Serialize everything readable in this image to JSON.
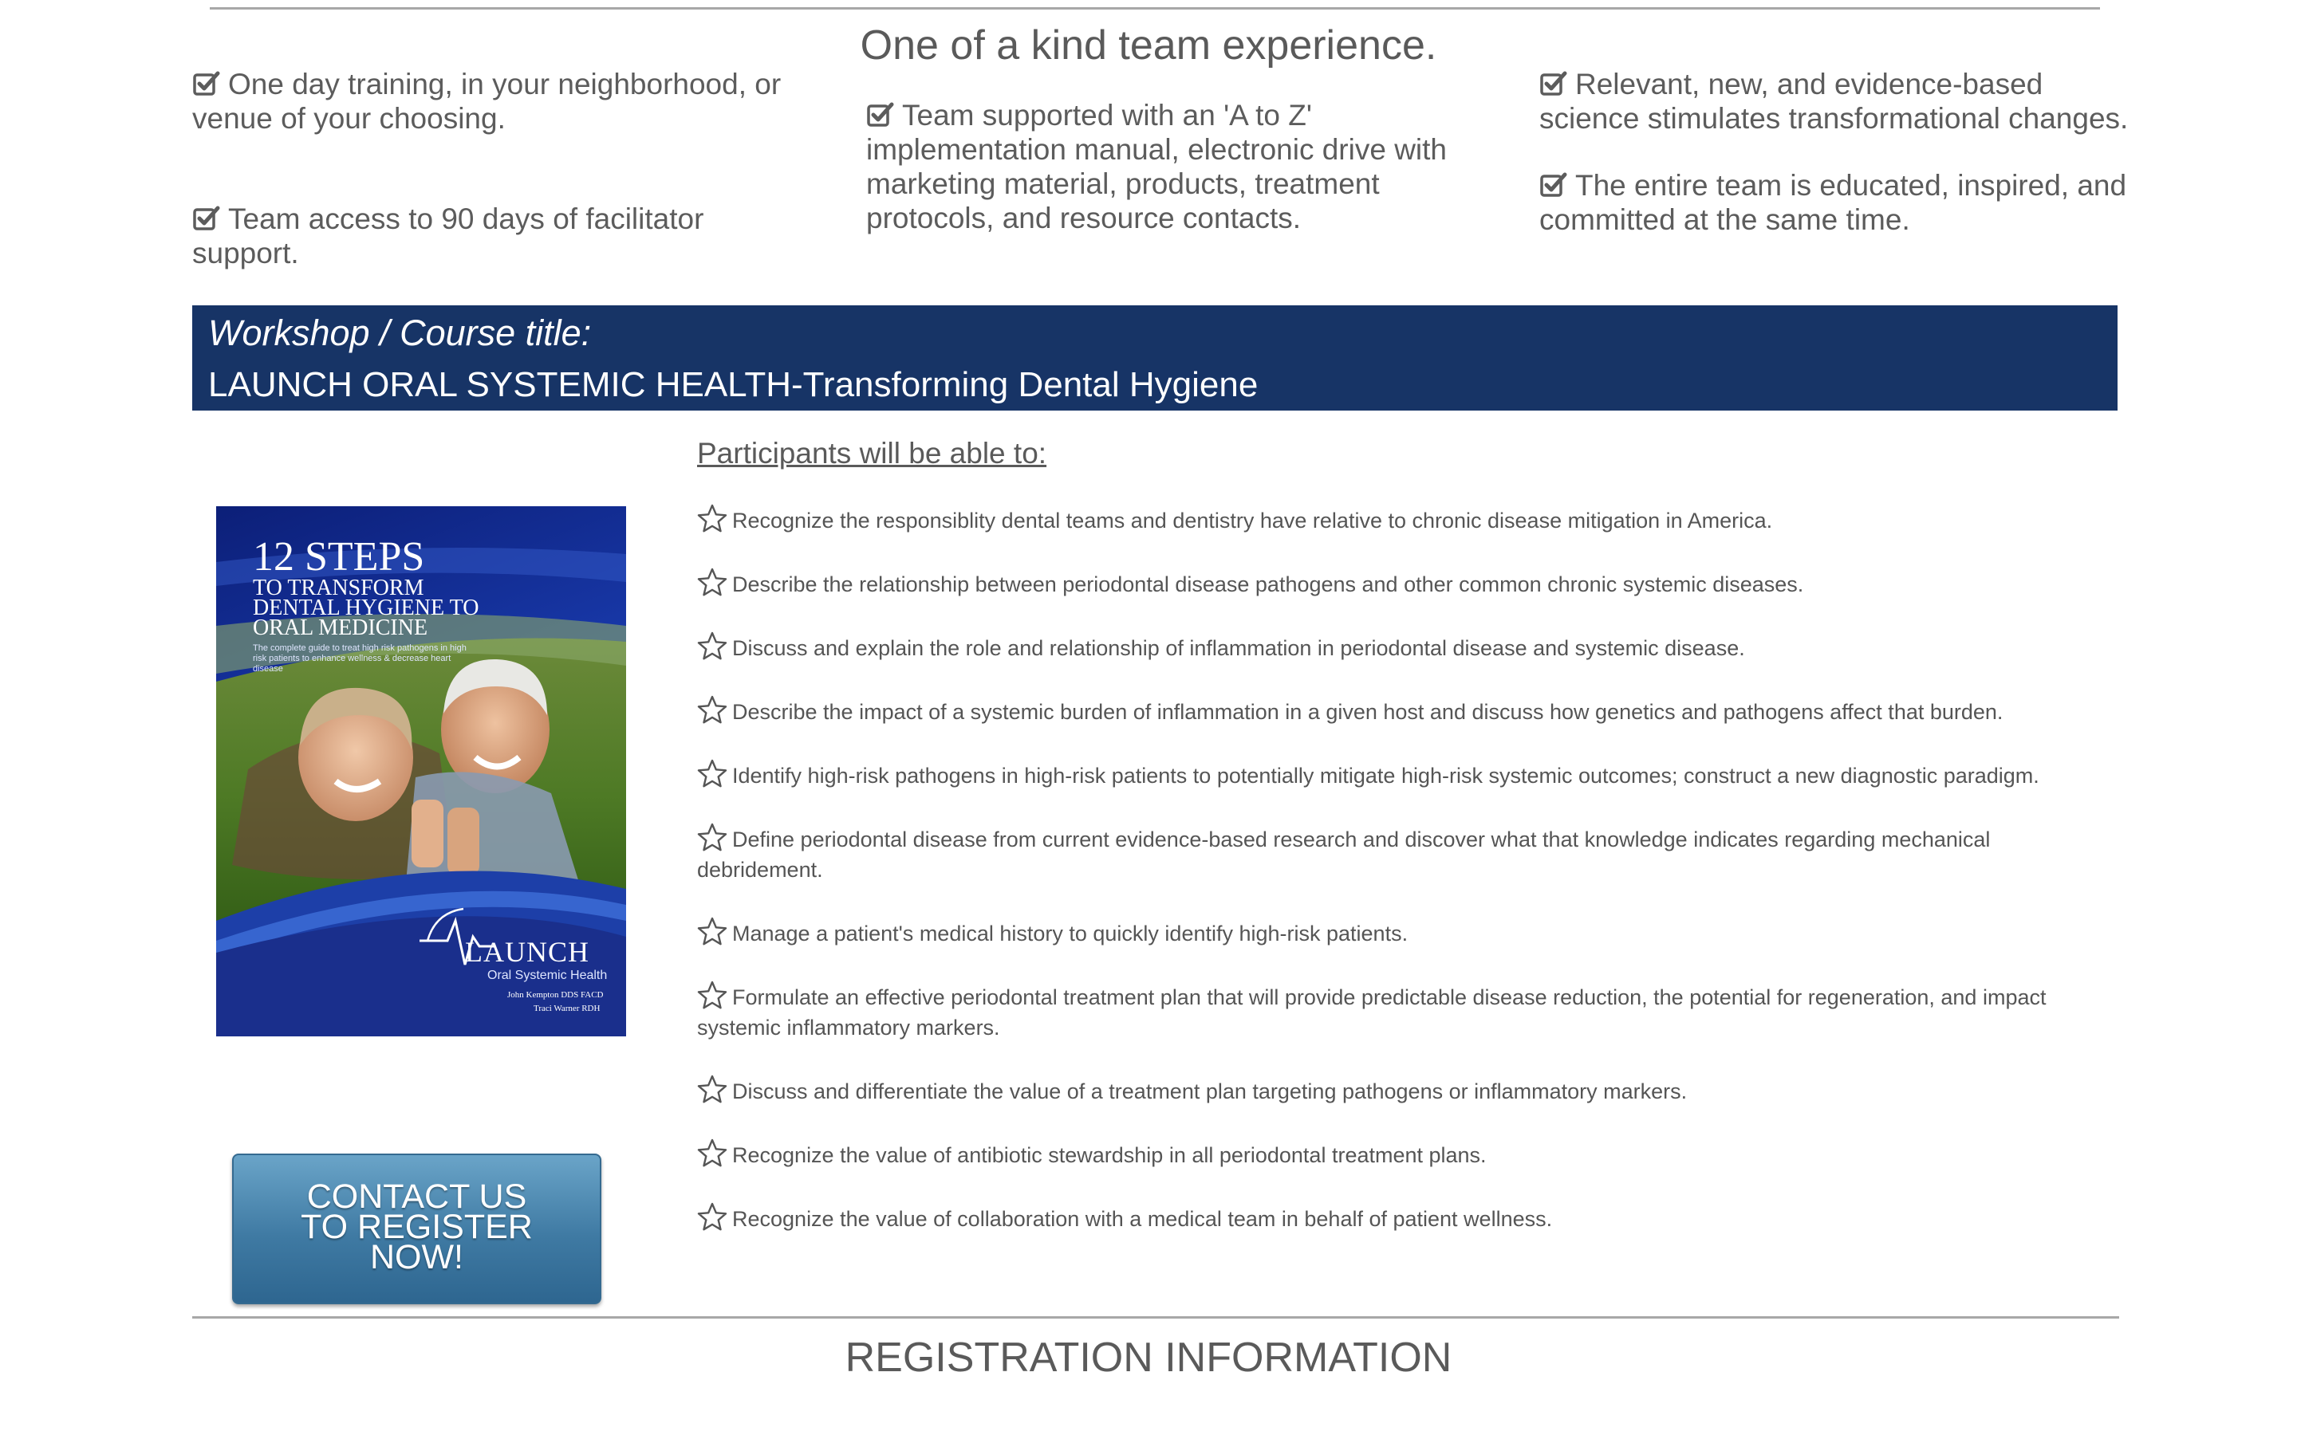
{
  "experience": {
    "title": "One of a kind team experience.",
    "features": [
      "One day training, in your neighborhood, or venue of your choosing.",
      "Team access to 90 days of facilitator support.",
      "Team supported with an 'A to Z' implementation manual, electronic drive with marketing material, products, treatment protocols, and resource contacts.",
      "Relevant, new, and evidence-based science stimulates transformational changes.",
      "The entire team is educated, inspired, and committed at the same time."
    ],
    "check_icon": "check-square-icon"
  },
  "course": {
    "label": "Workshop / Course title:",
    "title": "LAUNCH ORAL SYSTEMIC HEALTH-Transforming Dental Hygiene",
    "banner_color": "#173466"
  },
  "book": {
    "title_line1": "12 Steps",
    "title_line2": "to Transform",
    "title_line3": "Dental Hygiene to",
    "title_line4": "Oral Medicine",
    "subtitle": "The complete guide to treat high risk pathogens in high risk patients to enhance wellness & decrease heart disease",
    "brand": "LAUNCH",
    "brand_sub": "Oral Systemic Health",
    "author1": "John Kempton DDS FACD",
    "author2": "Traci Warner RDH"
  },
  "cta": {
    "line1": "CONTACT US",
    "line2": "TO REGISTER",
    "line3": "NOW!"
  },
  "participants": {
    "heading": "Participants will be able to:",
    "star_icon": "star-outline-icon",
    "objectives": [
      "Recognize the responsiblity dental teams and dentistry have relative to chronic disease mitigation in America.",
      "Describe the relationship between periodontal disease pathogens and other common chronic systemic diseases.",
      "Discuss and explain the role and relationship of inflammation in periodontal disease and systemic disease.",
      "Describe the impact of a systemic burden of inflammation in a given host and discuss how genetics and pathogens affect that burden.",
      "Identify high-risk pathogens in high-risk patients to potentially mitigate high-risk systemic outcomes; construct a new diagnostic paradigm.",
      "Define periodontal disease from current evidence-based research and discover what that knowledge indicates regarding mechanical debridement.",
      "Manage a patient's medical history to quickly identify high-risk patients.",
      "Formulate an effective periodontal treatment plan that will provide predictable disease reduction, the potential for regeneration, and impact systemic inflammatory markers.",
      "Discuss and differentiate the value of a treatment plan targeting pathogens or inflammatory markers.",
      "Recognize the value of antibiotic stewardship in all periodontal treatment plans.",
      "Recognize the value of collaboration with a medical team in behalf of patient wellness."
    ]
  },
  "registration": {
    "title": "REGISTRATION INFORMATION"
  }
}
